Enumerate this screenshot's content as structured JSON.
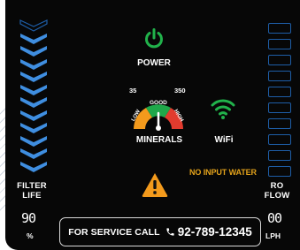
{
  "status": {
    "power_label": "POWER",
    "minerals_label": "MINERALS",
    "wifi_label": "WiFi",
    "filter_life_label_line1": "FILTER",
    "filter_life_label_line2": "LIFE",
    "filter_life_value": "90",
    "filter_life_unit": "%",
    "filter_life_level_percent": 90,
    "ro_flow_label_line1": "RO",
    "ro_flow_label_line2": "FLOW",
    "ro_flow_value": "00",
    "ro_flow_unit": "LPH",
    "ro_flow_level_percent": 0,
    "warning_text": "NO INPUT WATER"
  },
  "gauge": {
    "min_tick": "35",
    "max_tick": "350",
    "low_label": "LOW",
    "good_label": "GOOD",
    "high_label": "HIGH"
  },
  "service": {
    "label": "FOR SERVICE CALL",
    "phone": "92-789-12345"
  },
  "colors": {
    "panel_bg": "#070707",
    "power_green": "#21b24b",
    "wifi_green": "#21b24b",
    "chevron_blue": "#3f8ee0",
    "bar_outline": "#1e5ea8",
    "warning_orange": "#f39a1c",
    "gauge_low": "#f39a1c",
    "gauge_good": "#1fa84a",
    "gauge_high": "#e23b2e"
  },
  "icons": {
    "power": "power-icon",
    "wifi": "wifi-icon",
    "warning": "warning-icon",
    "phone": "phone-icon",
    "gauge": "minerals-gauge-icon"
  }
}
